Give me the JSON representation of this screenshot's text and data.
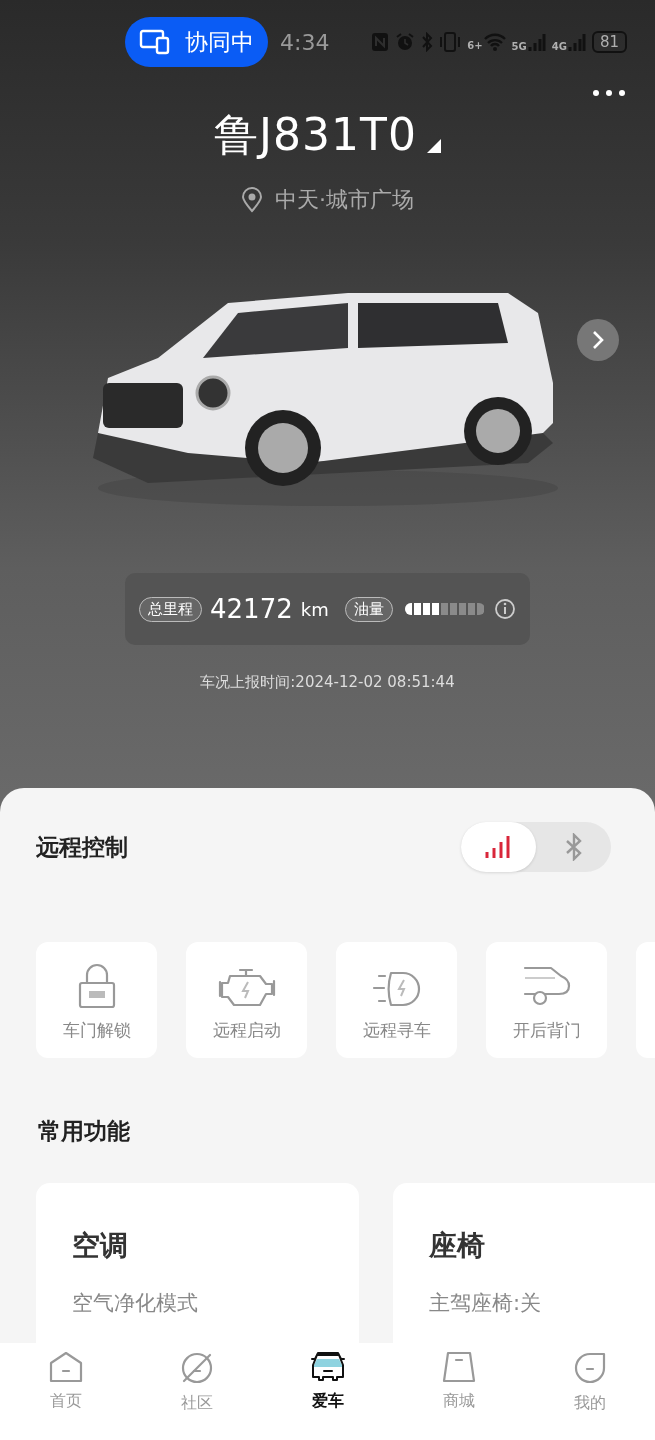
{
  "status_bar": {
    "collab_label": "协同中",
    "time": "4:34",
    "wifi_label": "6+",
    "signals": [
      {
        "label": "5G"
      },
      {
        "label": "4G"
      }
    ],
    "battery": "81"
  },
  "vehicle": {
    "plate": "鲁J831T0",
    "location": "中天·城市广场"
  },
  "stats": {
    "mileage_label": "总里程",
    "mileage": "42172",
    "mileage_unit": "km",
    "fuel_label": "油量",
    "fuel": {
      "level": 0.44
    }
  },
  "report_time": "车况上报时间:2024-12-02 08:51:44",
  "remote_control": {
    "title": "远程控制",
    "modes": [
      {
        "kind": "cellular",
        "selected": true
      },
      {
        "kind": "bluetooth",
        "selected": false
      }
    ],
    "items": [
      {
        "kind": "lock",
        "label": "车门解锁"
      },
      {
        "kind": "engine",
        "label": "远程启动"
      },
      {
        "kind": "light",
        "label": "远程寻车"
      },
      {
        "kind": "tailgate",
        "label": "开后背门"
      }
    ]
  },
  "common_functions": {
    "title": "常用功能",
    "cards": [
      {
        "title": "空调",
        "subtitle": "空气净化模式"
      },
      {
        "title": "座椅",
        "subtitle": "主驾座椅:关"
      }
    ]
  },
  "tab_bar": [
    {
      "kind": "home",
      "label": "首页",
      "selected": false
    },
    {
      "kind": "community",
      "label": "社区",
      "selected": false
    },
    {
      "kind": "car",
      "label": "爱车",
      "selected": true
    },
    {
      "kind": "shop",
      "label": "商城",
      "selected": false
    },
    {
      "kind": "me",
      "label": "我的",
      "selected": false
    }
  ]
}
